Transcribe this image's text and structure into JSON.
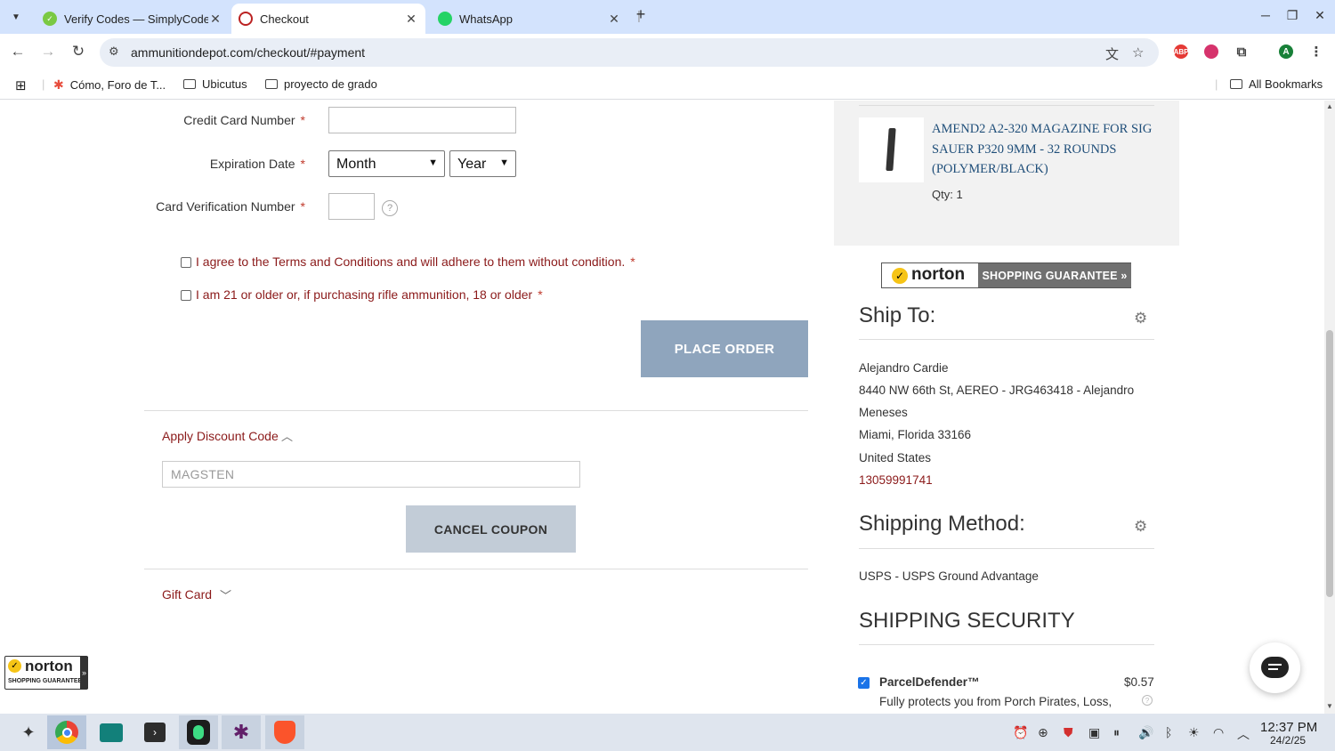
{
  "browser": {
    "tabs": [
      {
        "title": "Verify Codes — SimplyCodes",
        "active": false
      },
      {
        "title": "Checkout",
        "active": true
      },
      {
        "title": "WhatsApp",
        "active": false
      }
    ],
    "new_tab_symbol": "+",
    "url": "ammunitiondepot.com/checkout/#payment",
    "profile_initial": "A",
    "bookmarks": [
      "Cómo, Foro de T...",
      "Ubicutus",
      "proyecto de grado"
    ],
    "all_bookmarks": "All Bookmarks",
    "ext_abp": "ABP"
  },
  "payment": {
    "cc_label": "Credit Card Number",
    "exp_label": "Expiration Date",
    "month_value": "Month",
    "year_value": "Year",
    "cvv_label": "Card Verification Number",
    "required_marker": "*",
    "cvv_help": "?",
    "terms_text": "I agree to the Terms and Conditions and will adhere to them without condition.",
    "age_text": "I am 21 or older or, if purchasing rifle ammunition, 18 or older",
    "place_order": "PLACE ORDER"
  },
  "discount": {
    "title": "Apply Discount Code",
    "code_value": "MAGSTEN",
    "cancel_button": "CANCEL COUPON"
  },
  "gift_card": {
    "title": "Gift Card"
  },
  "order_item": {
    "name": "AMEND2 A2-320 MAGAZINE FOR SIG SAUER P320 9MM - 32 ROUNDS (POLYMER/BLACK)",
    "qty": "Qty: 1"
  },
  "norton": {
    "brand": "norton",
    "guarantee": "SHOPPING GUARANTEE »",
    "badge_sub": "SHOPPING GUARANTEE"
  },
  "ship_to": {
    "title": "Ship To:",
    "name": "Alejandro Cardie",
    "address1": "8440 NW 66th St, AEREO - JRG463418 - Alejandro",
    "address2": "Meneses",
    "city": "Miami, Florida 33166",
    "country": "United States",
    "phone": "13059991741"
  },
  "shipping_method": {
    "title": "Shipping Method:",
    "value": "USPS - USPS Ground Advantage"
  },
  "shipping_security": {
    "title": "SHIPPING SECURITY",
    "product": "ParcelDefender™",
    "price": "$0.57",
    "desc": "Fully protects you from Porch Pirates, Loss,",
    "checked": true
  },
  "taskbar": {
    "time": "12:37 PM",
    "date": "24/2/25"
  },
  "colors": {
    "place_order_bg": "#8fa5bd",
    "cancel_coupon_bg": "#c2ccd7",
    "link_red": "#8b1a1a",
    "item_link_blue": "#1f4e79",
    "norton_yellow": "#f6c416"
  }
}
